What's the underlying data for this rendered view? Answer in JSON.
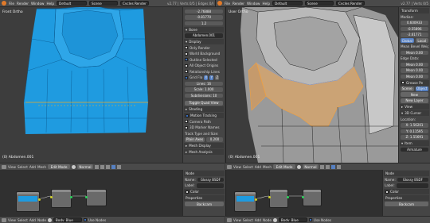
{
  "colors": {
    "accent": "#5680c2",
    "mesh_blue": "#1f9be0",
    "mesh_selected": "#e8a85a",
    "header_bg": "#4a4a4a",
    "panel_bg": "#454545",
    "viewport_bg": "#3d3d3d"
  },
  "top_left": {
    "menus": [
      "File",
      "Render",
      "Window",
      "Help"
    ],
    "screen": "Default",
    "scene": "Scene",
    "engine": "Cycles Render",
    "info": "v2.77 | Verts 0/5 | Edges 0/8"
  },
  "top_right": {
    "menus": [
      "File",
      "Render",
      "Window",
      "Help"
    ],
    "screen": "Default",
    "scene": "Scene",
    "engine": "Cycles Render",
    "info": "v2.77 | Verts 0/5"
  },
  "left_viewport": {
    "label": "Front Ortho",
    "object_label": "(0) Abdomen.001"
  },
  "right_viewport": {
    "label": "User Ortho",
    "object_label": "(0) Abdomen.001"
  },
  "left_props": {
    "values": [
      "-2.76888",
      "-0.81770",
      "1.2"
    ],
    "bone_header": "Bone",
    "bone_name": "Abdomen.001",
    "display_header": "Display",
    "only_render": "Only Render",
    "world_background": "World Background",
    "outline_selected": "Outline Selected",
    "all_object_origins": "All Object Origins",
    "relationship_lines": "Relationship Lines",
    "grid_floor": "Grid Flo",
    "axes": [
      "X",
      "Y",
      "Z"
    ],
    "lines": "Lines: 16",
    "scale": "Scale: 1.000",
    "subdiv": "Subdivisions: 10",
    "toggle_quad": "Toggle Quad View",
    "shading": "Shading",
    "motion_tracking": "Motion Tracking",
    "camera_path": "Camera Path",
    "marker_names": "3D Marker Names",
    "track_type": "Track Type and Size:",
    "plain_axes": "Plain Axes",
    "size": "0.200",
    "mesh_display": "Mesh Display",
    "mesh_analysis": "Mesh Analysis"
  },
  "right_props": {
    "transform": "Transform",
    "median": "Median:",
    "median_values": [
      "0.600933",
      "-0.55896",
      "-2.61771"
    ],
    "global": "Global",
    "local": "Local",
    "mean_bw": "Mean Bevel Weight:",
    "mean_bw_val": "Mean 0.00",
    "edge_data": "Edge Data:",
    "mean_cr": "Mean 0.00",
    "mean_bw2": "Mean 0.00",
    "mean_ec": "Mean 0.00",
    "grease_pencil": "Grease Pe",
    "scene_btn": "Scene",
    "object_btn": "Object",
    "new_btn": "New",
    "new_layer": "New Layer",
    "view": "View",
    "cursor": "3D Cursor",
    "location": "Location:",
    "cursor_vals": [
      "X: 1.56201",
      "Y: 0.11595",
      "Z: 1.55691"
    ],
    "item": "Item",
    "armature": "Armature"
  },
  "left_header": {
    "view": "View",
    "select": "Select",
    "add": "Add",
    "mesh": "Mesh",
    "mode": "Edit Mode",
    "pivot": "Normal"
  },
  "right_header": {
    "view": "View",
    "select": "Select",
    "add": "Add",
    "mesh": "Mesh",
    "mode": "Edit Mode",
    "pivot": "Normal"
  },
  "left_node_side": {
    "node": "Node",
    "name_label": "Name:",
    "name_value": "Glossy BSDF",
    "label_label": "Label:",
    "color": "Color",
    "properties": "Properties",
    "backdrop": "Backcam"
  },
  "right_node_side": {
    "node": "Node",
    "name_label": "Name:",
    "name_value": "Glossy BSDF",
    "label_label": "Label:",
    "color": "Color",
    "properties": "Properties",
    "backdrop": "Backcam"
  },
  "left_node_header": {
    "view": "View",
    "select": "Select",
    "add": "Add",
    "node": "Node",
    "material": "Body_Blue",
    "use_nodes": "Use Nodes"
  },
  "right_node_header": {
    "view": "View",
    "select": "Select",
    "add": "Add",
    "node": "Node",
    "material": "Body_Blue",
    "use_nodes": "Use Nodes"
  }
}
